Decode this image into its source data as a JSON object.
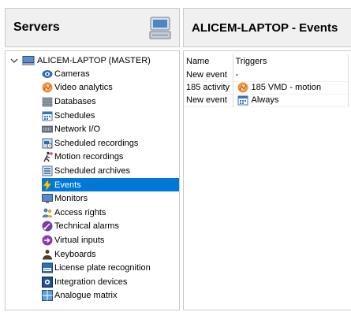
{
  "left_panel": {
    "title": "Servers",
    "root": {
      "label": "ALICEM-LAPTOP (MASTER)"
    },
    "items": [
      {
        "label": "Cameras",
        "icon": "camera-icon"
      },
      {
        "label": "Video analytics",
        "icon": "video-analytics-icon"
      },
      {
        "label": "Databases",
        "icon": "database-icon"
      },
      {
        "label": "Schedules",
        "icon": "calendar-icon"
      },
      {
        "label": "Network I/O",
        "icon": "network-io-icon"
      },
      {
        "label": "Scheduled recordings",
        "icon": "scheduled-recording-icon"
      },
      {
        "label": "Motion recordings",
        "icon": "motion-recording-icon"
      },
      {
        "label": "Scheduled archives",
        "icon": "archive-icon"
      },
      {
        "label": "Events",
        "icon": "lightning-icon",
        "selected": true
      },
      {
        "label": "Monitors",
        "icon": "monitor-icon"
      },
      {
        "label": "Access rights",
        "icon": "users-icon"
      },
      {
        "label": "Technical alarms",
        "icon": "alarm-icon"
      },
      {
        "label": "Virtual inputs",
        "icon": "virtual-input-icon"
      },
      {
        "label": "Keyboards",
        "icon": "keyboard-icon"
      },
      {
        "label": "License plate recognition",
        "icon": "license-plate-icon"
      },
      {
        "label": "Integration devices",
        "icon": "integration-icon"
      },
      {
        "label": "Analogue matrix",
        "icon": "matrix-icon"
      }
    ]
  },
  "right_panel": {
    "title": "ALICEM-LAPTOP - Events",
    "columns": [
      "Name",
      "Triggers"
    ],
    "rows": [
      {
        "name": "New event",
        "trigger": "-",
        "trigger_icon": ""
      },
      {
        "name": "185 activity",
        "trigger": "185 VMD - motion",
        "trigger_icon": "video-analytics-icon"
      },
      {
        "name": "New event",
        "trigger": "Always",
        "trigger_icon": "calendar-icon"
      }
    ]
  },
  "colors": {
    "selection": "#0078d7",
    "header_bg": "#f0f0f0",
    "border": "#c9c9c9"
  }
}
